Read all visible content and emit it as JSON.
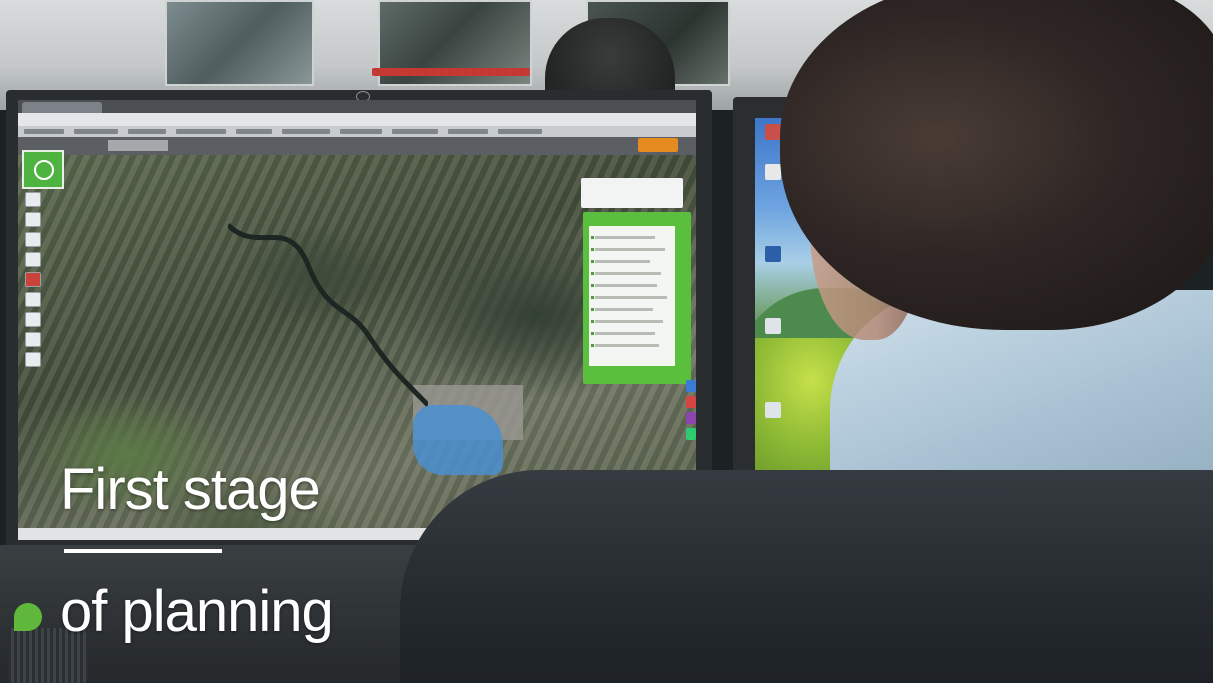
{
  "caption": {
    "line1": "First stage",
    "line2": "of planning"
  },
  "colors": {
    "map_panel_green": "#5bbf3e",
    "logo_green": "#4fb342",
    "header_orange": "#e58b1f",
    "flood_blue": "#4a8fd0",
    "caption_text": "#ffffff"
  },
  "icons": [
    "monitor-brand-logo-icon",
    "app-logo-icon",
    "map-tool-icon",
    "desktop-icon"
  ]
}
